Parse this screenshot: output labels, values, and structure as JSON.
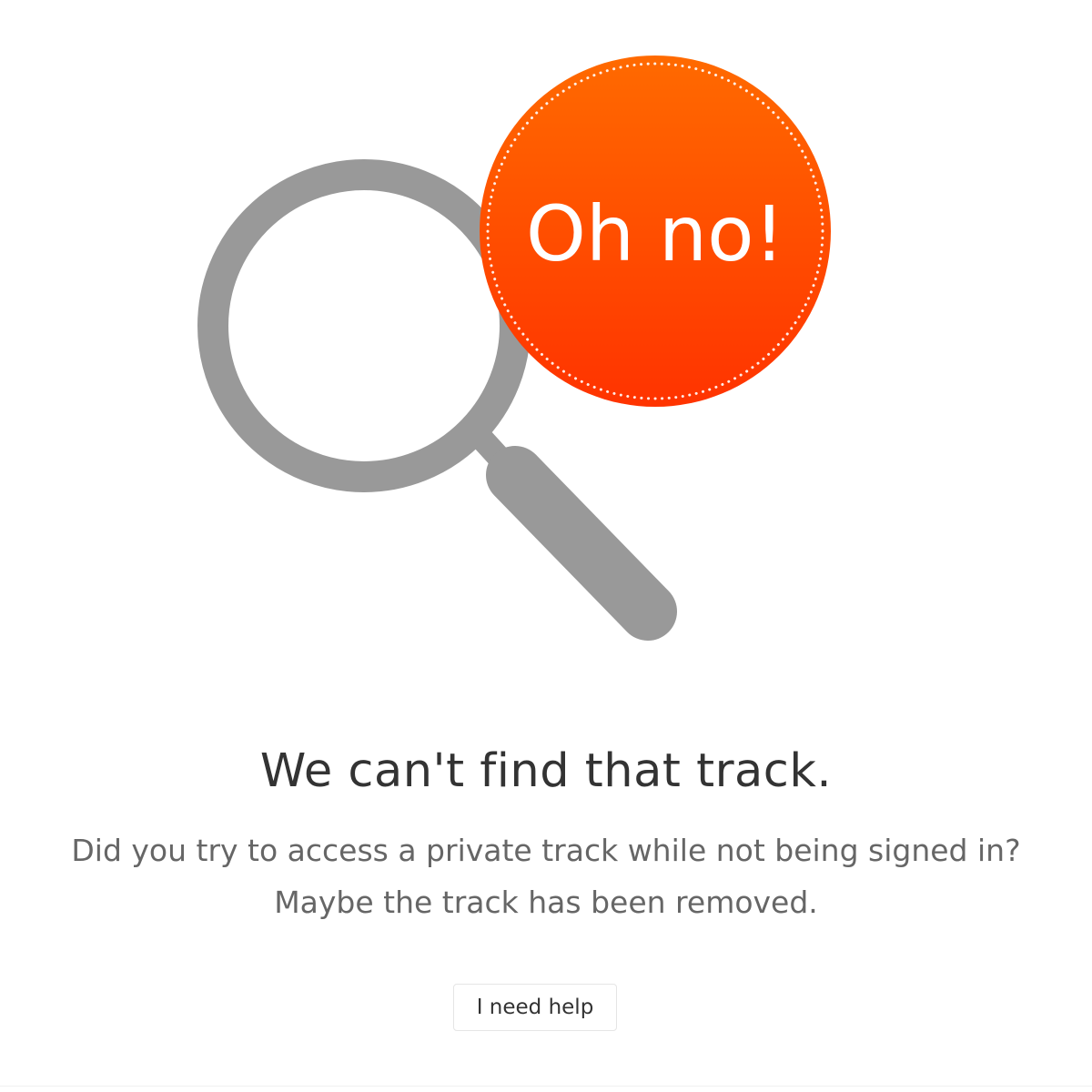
{
  "illustration": {
    "badge_text": "Oh no!",
    "icon": "magnifying-glass-icon",
    "colors": {
      "magnifier": "#999999",
      "badge_top": "#ff6a00",
      "badge_bottom": "#ff3300",
      "badge_text": "#ffffff"
    }
  },
  "error": {
    "title": "We can't find that track.",
    "message_line1": "Did you try to access a private track while not being signed in?",
    "message_line2": "Maybe the track has been removed."
  },
  "actions": {
    "help_label": "I need help"
  },
  "colors": {
    "title": "#333333",
    "message": "#666666",
    "button_border": "#e5e5e5"
  }
}
